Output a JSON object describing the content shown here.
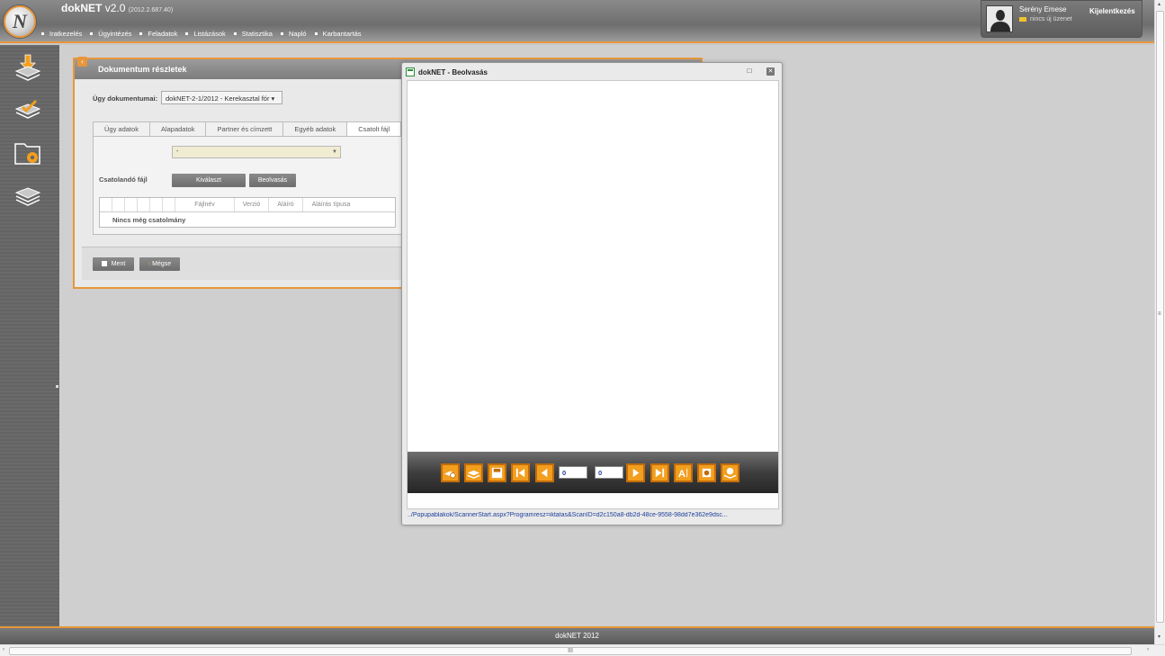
{
  "app": {
    "name": "dokNET",
    "version": "v2.0",
    "build": "(2012.2.687.40)"
  },
  "menu": [
    "Iratkezelés",
    "Ügyintézés",
    "Feladatok",
    "Listázások",
    "Statisztika",
    "Napló",
    "Karbantartás"
  ],
  "user": {
    "name": "Serény Emese",
    "messages": "nincs új üzenet",
    "logout": "Kijelentkezés"
  },
  "sidebar": {
    "icons": [
      "inbox-download-icon",
      "approve-stack-icon",
      "folder-settings-icon",
      "layers-icon"
    ]
  },
  "panel": {
    "title": "Dokumentum részletek",
    "toggle_glyph": "‹",
    "ugy_label": "Ügy dokumentumai:",
    "ugy_value": "dokNET-2-1/2012 - Kerekasztal fór ▾",
    "tabs": [
      "Ügy adatok",
      "Alapadatok",
      "Partner és címzett",
      "Egyéb adatok",
      "Csatolt fájl"
    ],
    "combo_value": "-",
    "attach_label": "Csatolandó fájl",
    "select_button": "Kiválaszt",
    "scan_button": "Beolvasás",
    "grid_columns": [
      "",
      "",
      "",
      "",
      "",
      "",
      "Fájlnév",
      "Verzió",
      "Aláíró",
      "Aláírás típusa"
    ],
    "grid_empty": "Nincs még csatolmány",
    "save_button": "Ment",
    "cancel_button": "Mégse"
  },
  "popup": {
    "title": "dokNET - Beolvasás",
    "max_glyph": "□",
    "close_glyph": "✕",
    "page_current": "0",
    "page_total": "0",
    "status_url": "../Popupablakok/ScannerStart.aspx?Programresz=iktatas&ScanID=d2c150a8-db2d-48ce-9558-98dd7e362e9dsc..."
  },
  "footer": {
    "text": "dokNET 2012"
  },
  "scroll": {
    "grip": "III",
    "left": "‹",
    "right": "›",
    "up": "▴",
    "down": "▾",
    "mid": "≡"
  }
}
